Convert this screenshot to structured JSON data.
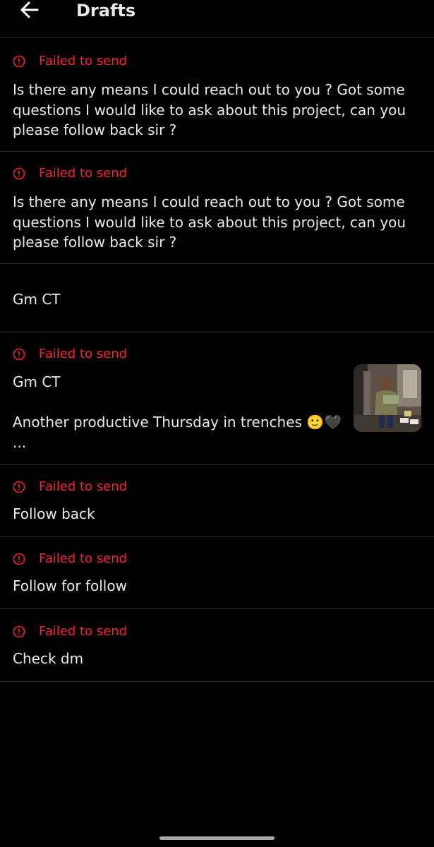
{
  "header": {
    "title": "Drafts",
    "back_icon": "arrow-left-icon"
  },
  "colors": {
    "background": "#000000",
    "text": "#e7e9ea",
    "error": "#f4212e",
    "divider": "#2a2d31"
  },
  "drafts": [
    {
      "status": "Failed to send",
      "text": "Is there any means I could reach out to you ? Got some\nquestions I would like to ask about this project, can you\nplease follow back sir ?"
    },
    {
      "status": "Failed to send",
      "text": "Is there any means I could reach out to you ? Got some\nquestions I would like to ask about this project, can you\nplease follow back sir ?"
    },
    {
      "text": "Gm CT"
    },
    {
      "status": "Failed to send",
      "text": "Gm CT\n\nAnother productive Thursday in trenches 🙂🖤\n...",
      "has_media": true
    },
    {
      "status": "Failed to send",
      "text": "Follow back"
    },
    {
      "status": "Failed to send",
      "text": "Follow for follow"
    },
    {
      "status": "Failed to send",
      "text": "Check dm"
    }
  ]
}
